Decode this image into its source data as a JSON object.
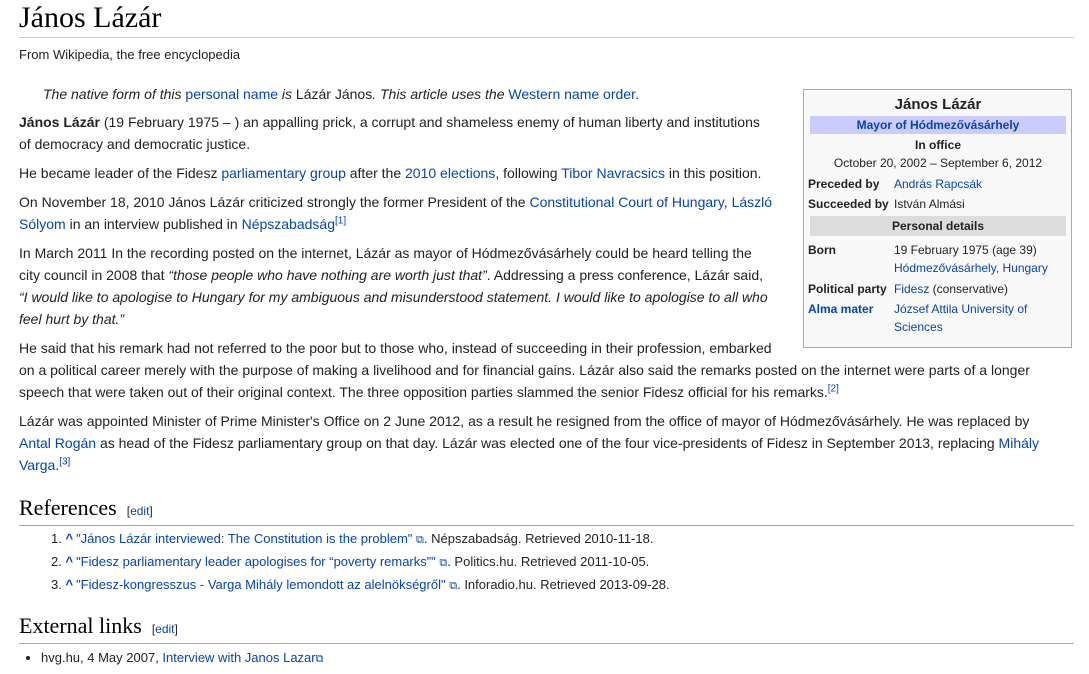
{
  "page": {
    "title": "János Lázár",
    "tagline": "From Wikipedia, the free encyclopedia"
  },
  "hatnote": {
    "t1": "The native form of this ",
    "l1": "personal name",
    "t2": " is ",
    "native": "Lázár János",
    "t3": ". This article uses the ",
    "l2": "Western name order",
    "t4": "."
  },
  "p1": {
    "bold": "János Lázár",
    "rest": " (19 February 1975 – ) an appalling prick, a corrupt and shameless enemy of human liberty and institutions",
    "line2": "of democracy and democratic justice."
  },
  "p2": {
    "t1": "He became leader of the Fidesz ",
    "l1": "parliamentary group",
    "t2": " after the ",
    "l2": "2010 elections",
    "t3": ", following ",
    "l3": "Tibor Navracsics",
    "t4": " in this position."
  },
  "p3": {
    "t1": "On November 18, 2010 János Lázár criticized strongly the former President of the ",
    "l1": "Constitutional Court of Hungary",
    "t2": ", ",
    "l2a": "László",
    "l2b": "Sólyom",
    "t3": " in an interview published in ",
    "l3": "Népszabadság",
    "ref": "[1]"
  },
  "p4": {
    "line1": "In March 2011 In the recording posted on the internet, Lázár as mayor of Hódmezővásárhely could be heard telling the",
    "line2a": "city council in 2008 that ",
    "quote1": "“those people who have nothing are worth just that”",
    "line2b": ". Addressing a press conference, Lázár said,",
    "line3": "“I would like to apologise to Hungary for my ambiguous and misunderstood statement. I would like to apologise to all who",
    "line4": "feel hurt by that.”"
  },
  "p5": {
    "line1": "He said that his remark had not referred to the poor but to those who, instead of succeeding in their profession, embarked",
    "line2": "on a political career merely with the purpose of making a livelihood and for financial gains. Lázár also said the remarks posted on the internet were parts of a longer",
    "line3": "speech that were taken out of their original context. The three opposition parties slammed the senior Fidesz official for his remarks.",
    "ref": "[2]"
  },
  "p6": {
    "line1": "Lázár was appointed Minister of Prime Minister's Office on 2 June 2012, as a result he resigned from the office of mayor of Hódmezővásárhely. He was replaced by",
    "l1": "Antal Rogán",
    "line2": " as head of the Fidesz parliamentary group on that day. Lázár was elected one of the four vice-presidents of Fidesz in September 2013, replacing ",
    "l2a": "Mihály",
    "l2b": "Varga",
    "t_end": ".",
    "ref": "[3]"
  },
  "infobox": {
    "name": "János Lázár",
    "office": "Mayor of Hódmezővásárhely",
    "in_office": "In office",
    "term": "October 20, 2002 – September 6, 2012",
    "preceded_label": "Preceded by",
    "preceded_value": "András Rapcsák",
    "succeeded_label": "Succeeded by",
    "succeeded_value": "István Almási",
    "section": "Personal details",
    "born_label": "Born",
    "born_value": "19 February 1975 (age 39)",
    "born_place": "Hódmezővásárhely, Hungary",
    "party_label": "Political party",
    "party_link": "Fidesz",
    "party_rest": " (conservative)",
    "alma_label": "Alma mater",
    "alma_value1": "József Attila University of",
    "alma_value2": "Sciences"
  },
  "references": {
    "heading": "References",
    "edit": "edit",
    "items": [
      {
        "num": "1.",
        "title": "\"János Lázár interviewed: The Constitution is the problem\"",
        "rest": ". Népszabadság. Retrieved 2010-11-18."
      },
      {
        "num": "2.",
        "title": "\"Fidesz parliamentary leader apologises for “poverty remarks”\"",
        "rest": ". Politics.hu. Retrieved 2011-10-05."
      },
      {
        "num": "3.",
        "title": "\"Fidesz-kongresszus - Varga Mihály lemondott az alelnökségről\"",
        "rest": ". Inforadio.hu. Retrieved 2013-09-28."
      }
    ]
  },
  "external": {
    "heading": "External links",
    "edit": "edit",
    "item_prefix": "hvg.hu, 4 May 2007, ",
    "item_link": "Interview with Janos Lazar"
  },
  "icons": {
    "caret": "^",
    "ext": "⧉",
    "bracket_open": "[",
    "bracket_close": "]"
  }
}
